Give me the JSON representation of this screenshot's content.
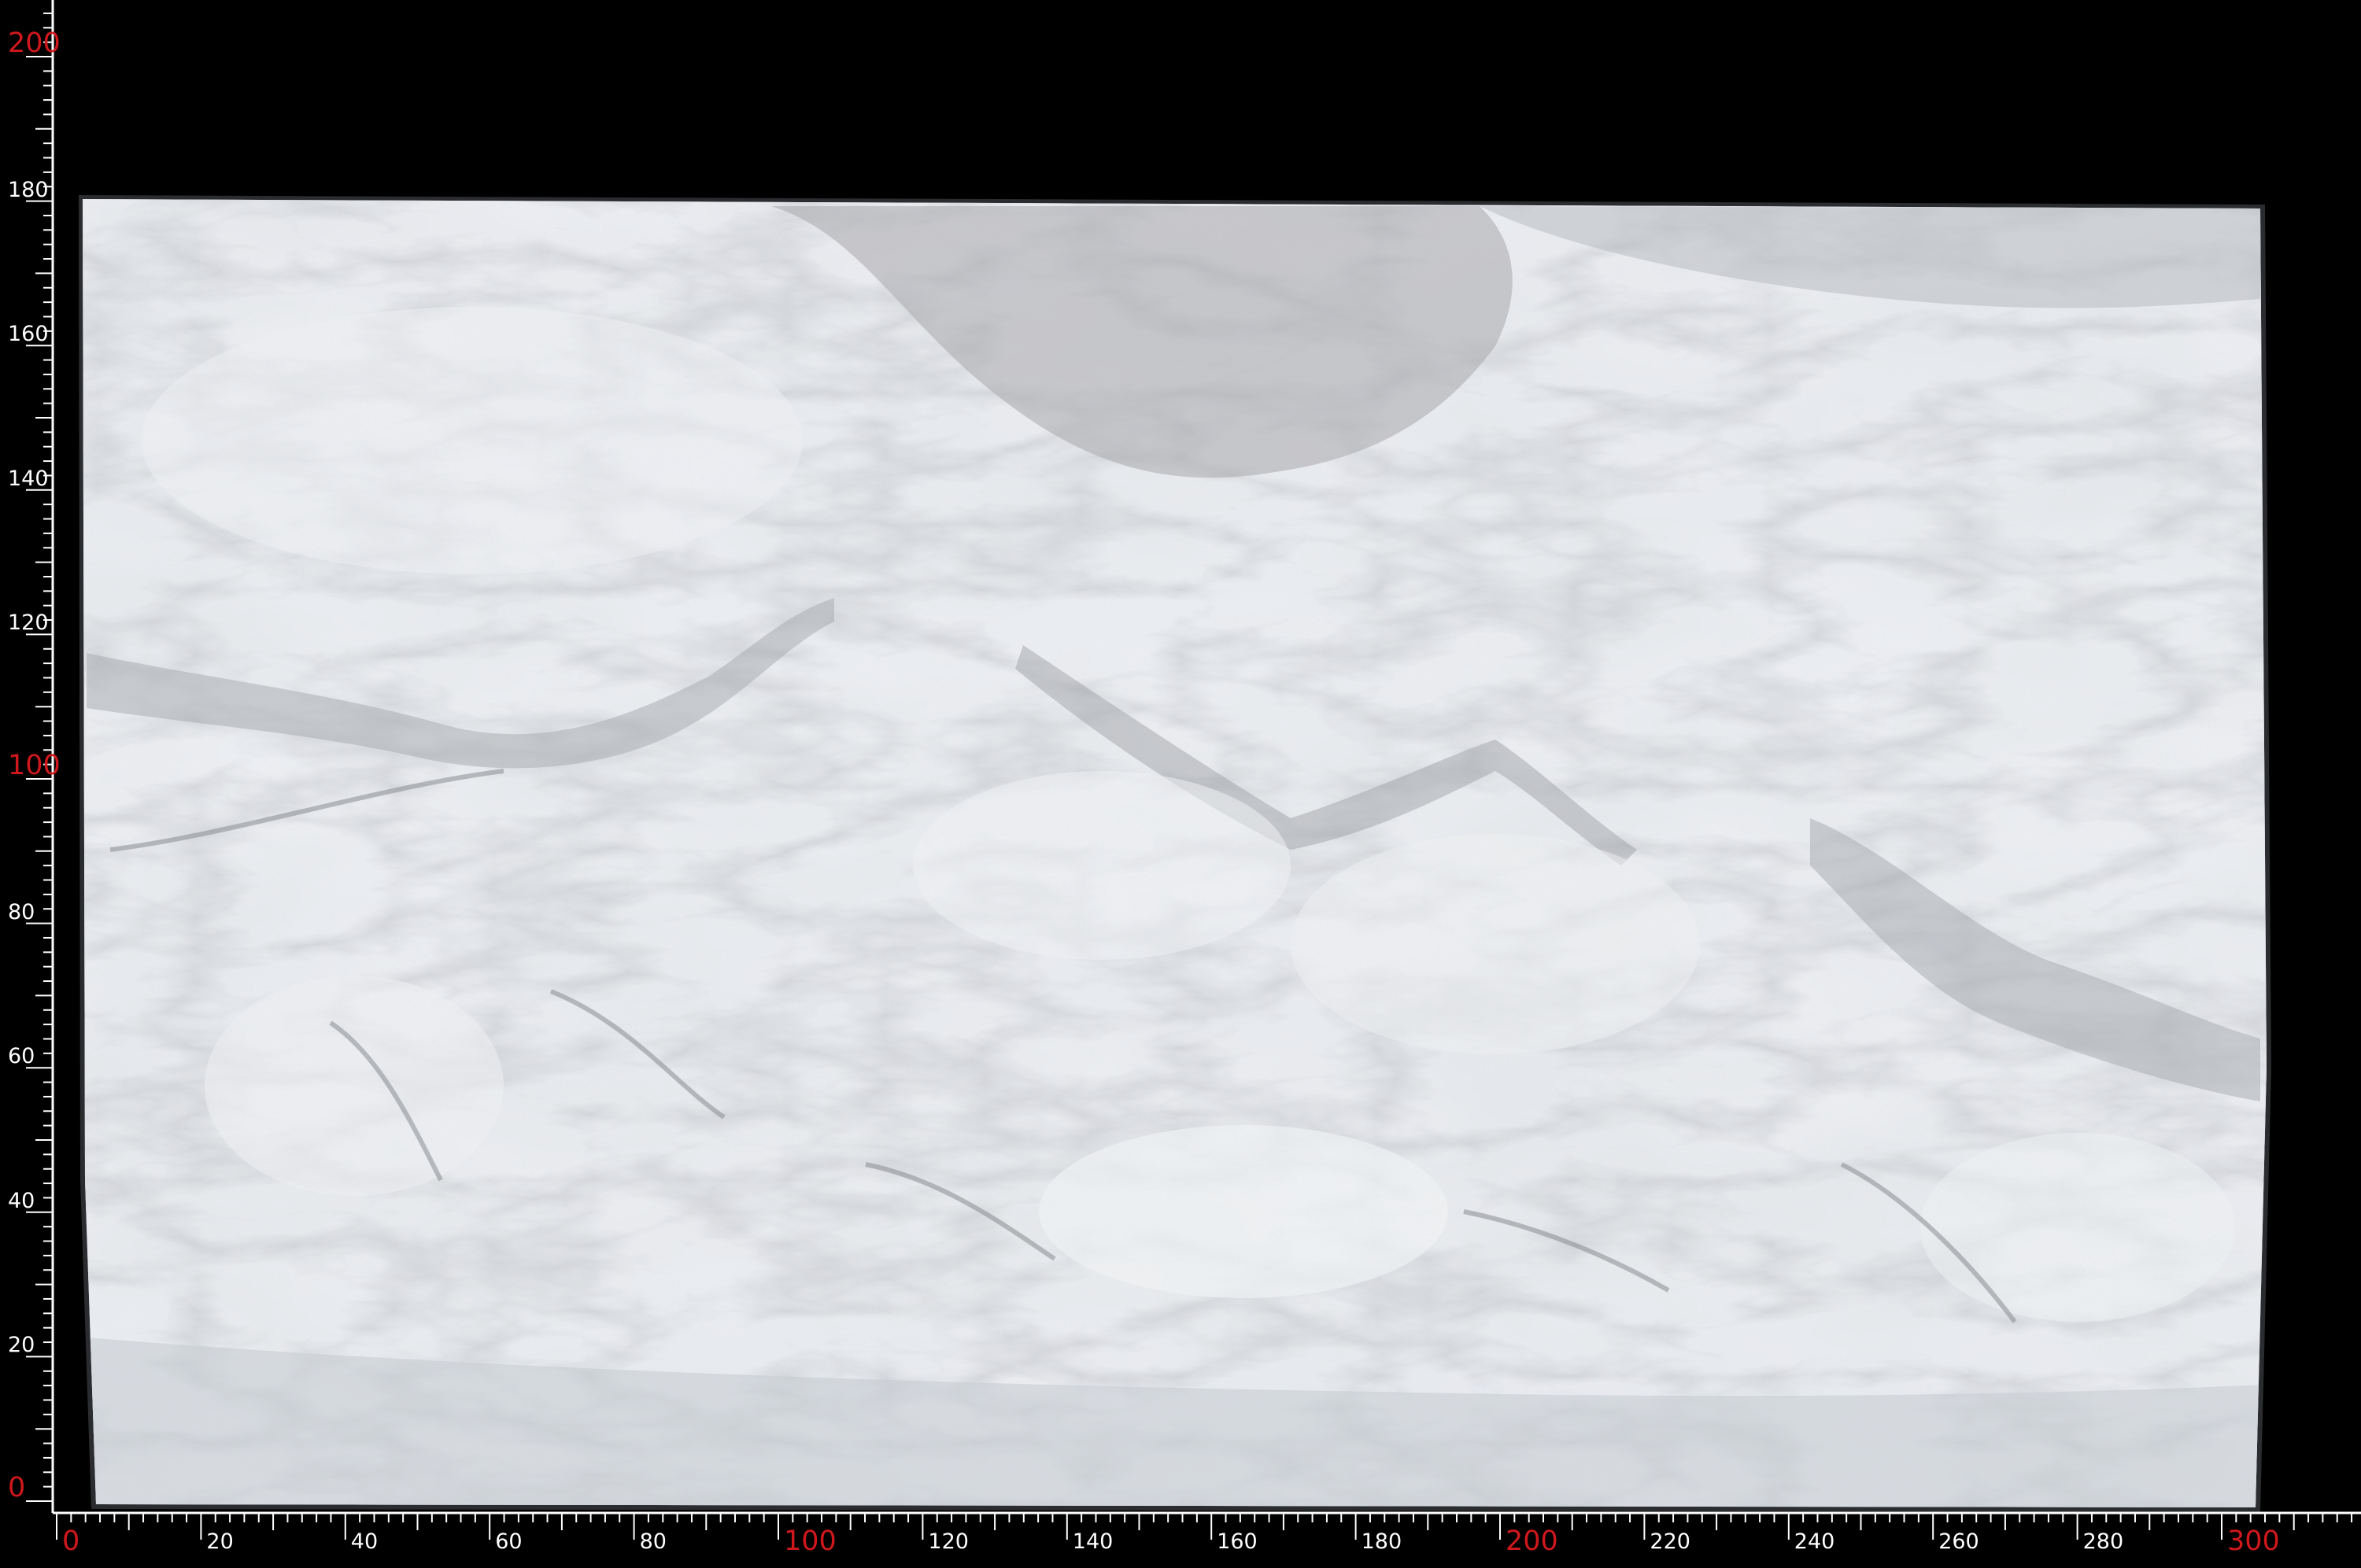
{
  "image": {
    "description_type": "stone-slab-scan",
    "background_color": "#000000",
    "ruler_major_color": "#d0181c",
    "ruler_minor_color": "#ffffff"
  },
  "ruler": {
    "x_labels": [
      "0",
      "20",
      "40",
      "60",
      "80",
      "100",
      "120",
      "140",
      "160",
      "180",
      "200",
      "220",
      "240",
      "260",
      "280",
      "300"
    ],
    "x_major": [
      "0",
      "100",
      "200",
      "300"
    ],
    "y_labels": [
      "200",
      "180",
      "160",
      "140",
      "120",
      "100",
      "80",
      "60",
      "40",
      "20",
      "0"
    ],
    "y_major": [
      "200",
      "100",
      "0"
    ],
    "x_range": [
      0,
      320
    ],
    "y_range": [
      0,
      200
    ]
  }
}
